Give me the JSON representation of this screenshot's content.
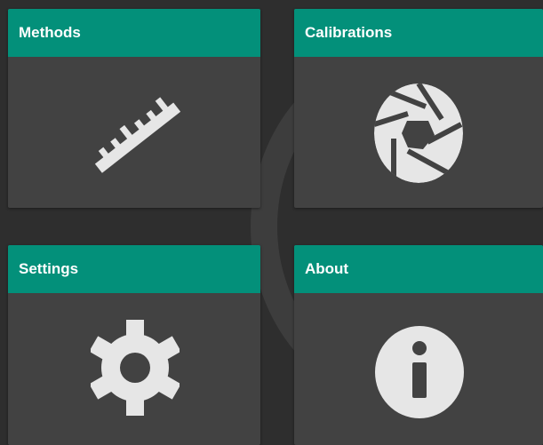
{
  "tiles": {
    "methods": {
      "label": "Methods",
      "icon": "ruler-icon"
    },
    "calibrations": {
      "label": "Calibrations",
      "icon": "aperture-icon"
    },
    "settings": {
      "label": "Settings",
      "icon": "gear-icon"
    },
    "about": {
      "label": "About",
      "icon": "info-icon"
    }
  },
  "colors": {
    "background": "#2e2e2e",
    "tile": "#424242",
    "header": "#03907a",
    "icon": "#e6e6e6"
  }
}
